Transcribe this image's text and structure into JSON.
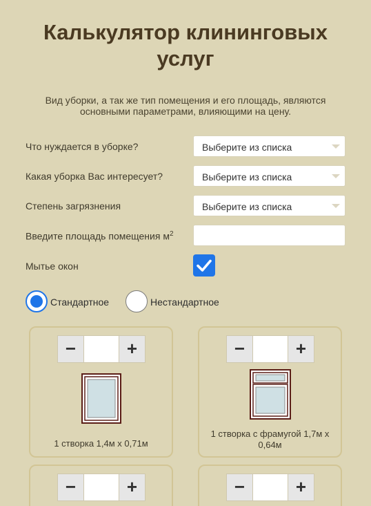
{
  "page": {
    "title": "Калькулятор клининговых услуг",
    "subtitle": "Вид уборки, а так же тип помещения и его площадь, являются основными параметрами, влияющими на цену."
  },
  "form": {
    "object_label": "Что нуждается в уборке?",
    "object_value": "Выберите из списка",
    "cleaning_label": "Какая уборка Вас интересует?",
    "cleaning_value": "Выберите из списка",
    "dirt_label": "Степень загрязнения",
    "dirt_value": "Выберите из списка",
    "area_label": "Введите площадь помещения м",
    "area_unit_sup": "2",
    "area_value": "",
    "windows_label": "Мытье окон",
    "windows_checked": true
  },
  "window_type": {
    "options": [
      "Стандартное",
      "Нестандартное"
    ],
    "selected": "Стандартное"
  },
  "windows": [
    {
      "caption": "1 створка 1,4м х 0,71м",
      "qty": "",
      "minus": "−",
      "plus": "+"
    },
    {
      "caption": "1 створка с фрамугой 1,7м х 0,64м",
      "qty": "",
      "minus": "−",
      "plus": "+"
    },
    {
      "caption": "",
      "qty": "",
      "minus": "−",
      "plus": "+"
    },
    {
      "caption": "",
      "qty": "",
      "minus": "−",
      "plus": "+"
    }
  ],
  "colors": {
    "background": "#ddd6b6",
    "accent": "#1f75e8",
    "title": "#4a3a22",
    "card_border": "#d2c595"
  }
}
